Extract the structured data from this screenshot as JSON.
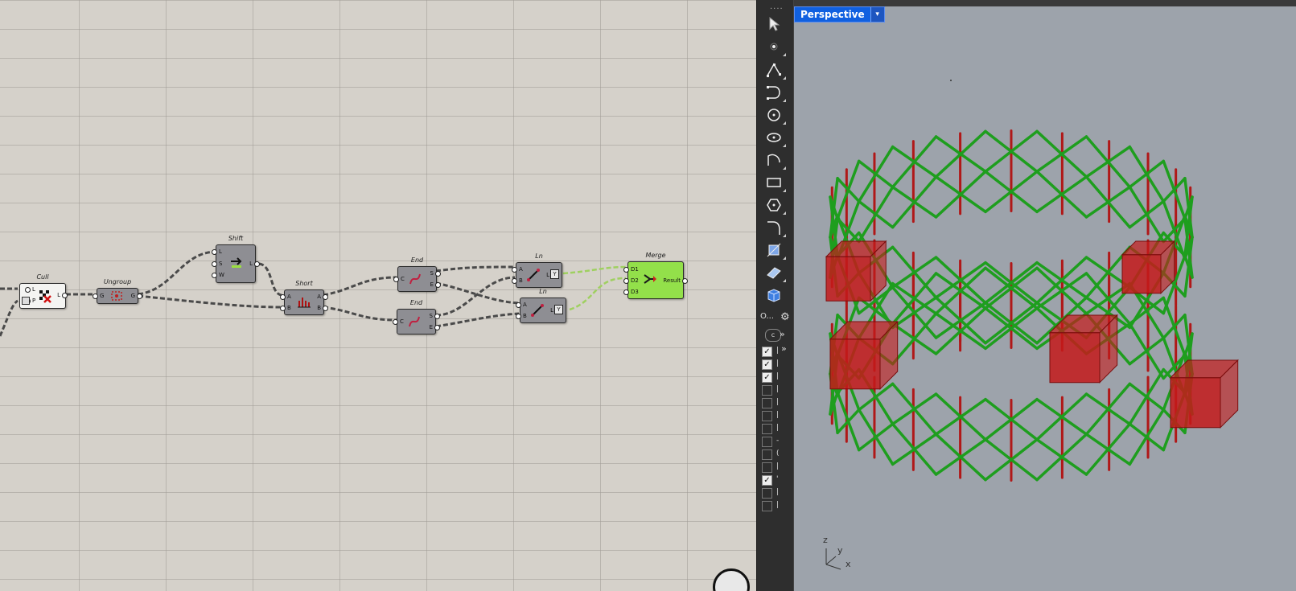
{
  "gh": {
    "components": {
      "cull": {
        "title": "Cull",
        "inputs": [
          "L",
          "P"
        ],
        "outputs": [
          "L"
        ]
      },
      "ungroup": {
        "title": "Ungroup",
        "inputs": [
          "G"
        ],
        "outputs": [
          "G"
        ]
      },
      "shift": {
        "title": "Shift",
        "inputs": [
          "L",
          "S",
          "W"
        ],
        "outputs": [
          "L"
        ]
      },
      "short": {
        "title": "Short",
        "inputs": [
          "A",
          "B"
        ],
        "outputs": [
          "A",
          "B"
        ]
      },
      "end1": {
        "title": "End",
        "inputs": [
          "C"
        ],
        "outputs": [
          "S",
          "E"
        ]
      },
      "end2": {
        "title": "End",
        "inputs": [
          "C"
        ],
        "outputs": [
          "S",
          "E"
        ]
      },
      "ln1": {
        "title": "Ln",
        "inputs": [
          "A",
          "B"
        ],
        "outputs": [
          "L"
        ]
      },
      "ln2": {
        "title": "Ln",
        "inputs": [
          "A",
          "B"
        ],
        "outputs": [
          "L"
        ]
      },
      "merge": {
        "title": "Merge",
        "inputs": [
          "D1",
          "D2",
          "D3"
        ],
        "outputs": [
          "Result"
        ]
      }
    }
  },
  "rhino": {
    "viewport_title": "Perspective",
    "viewport_menu_arrow": "▾",
    "search_placeholder": "O...",
    "axes": {
      "z": "z",
      "y": "y",
      "x": "x"
    },
    "toolbar_tools": [
      "select-arrow-icon",
      "point-icon",
      "polyline-icon",
      "curve-icon",
      "circle-icon",
      "ellipse-icon",
      "arc-icon",
      "rectangle-icon",
      "polygon-icon",
      "fillet-icon",
      "transform-icon",
      "surface-icon",
      "solid-box-icon"
    ],
    "layers": [
      {
        "checked": true,
        "mark": "|"
      },
      {
        "checked": true,
        "mark": "|"
      },
      {
        "checked": true,
        "mark": "|"
      },
      {
        "checked": false,
        "mark": "|"
      },
      {
        "checked": false,
        "mark": "|"
      },
      {
        "checked": false,
        "mark": "|"
      },
      {
        "checked": false,
        "mark": "|"
      },
      {
        "checked": false,
        "mark": "-"
      },
      {
        "checked": false,
        "mark": "("
      },
      {
        "checked": false,
        "mark": "|"
      },
      {
        "checked": true,
        "mark": "'"
      },
      {
        "checked": false,
        "mark": "|"
      },
      {
        "checked": false,
        "mark": "|"
      }
    ]
  },
  "colors": {
    "lattice_green": "#1e9e1e",
    "lattice_red": "#b01818",
    "box_red": "#c41a1a",
    "merge_green": "#93e04a",
    "viewport_bg": "#9da3ab"
  }
}
